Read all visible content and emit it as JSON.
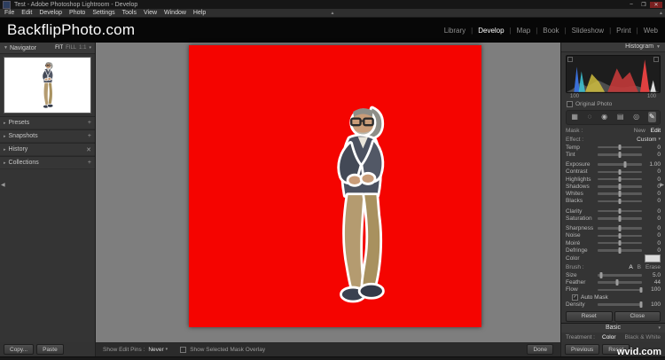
{
  "window": {
    "title": "Test - Adobe Photoshop Lightroom - Develop",
    "minimize": "–",
    "maximize": "❐",
    "close": "✕"
  },
  "menu": {
    "items": [
      "File",
      "Edit",
      "Develop",
      "Photo",
      "Settings",
      "Tools",
      "View",
      "Window",
      "Help"
    ]
  },
  "header": {
    "identity": "BackflipPhoto.com",
    "modules": [
      "Library",
      "Develop",
      "Map",
      "Book",
      "Slideshow",
      "Print",
      "Web"
    ],
    "active_module": "Develop",
    "separator": "|"
  },
  "left": {
    "navigator": {
      "title": "Navigator",
      "fit": "FIT",
      "fill": "FILL",
      "one_to_one": "1:1"
    },
    "panels": [
      {
        "label": "Presets",
        "action": "+"
      },
      {
        "label": "Snapshots",
        "action": "+"
      },
      {
        "label": "History",
        "action": "✕"
      },
      {
        "label": "Collections",
        "action": "+"
      }
    ],
    "copy_button": "Copy...",
    "paste_button": "Paste"
  },
  "toolbar": {
    "edit_pins_label": "Show Edit Pins :",
    "edit_pins_value": "Never",
    "overlay_label": "Show Selected Mask Overlay",
    "done_button": "Done"
  },
  "right": {
    "histogram": {
      "title": "Histogram",
      "info_left": "100",
      "info_right": "100",
      "original_photo": "Original Photo"
    },
    "tool_icons": {
      "crop": "▦",
      "spot_removal": "◌",
      "red_eye": "◉",
      "graduated_filter": "▤",
      "radial_filter": "◎",
      "adjustment_brush": "✎"
    },
    "mask": {
      "label": "Mask :",
      "new_label": "New",
      "edit_label": "Edit"
    },
    "effect": {
      "label": "Effect :",
      "value": "Custom"
    },
    "sliders": [
      {
        "label": "Temp",
        "value": "0"
      },
      {
        "label": "Tint",
        "value": "0"
      },
      {
        "label": "Exposure",
        "value": "1.00"
      },
      {
        "label": "Contrast",
        "value": "0"
      },
      {
        "label": "Highlights",
        "value": "0"
      },
      {
        "label": "Shadows",
        "value": "0"
      },
      {
        "label": "Whites",
        "value": "0"
      },
      {
        "label": "Blacks",
        "value": "0"
      },
      {
        "label": "Clarity",
        "value": "0"
      },
      {
        "label": "Saturation",
        "value": "0"
      },
      {
        "label": "Sharpness",
        "value": "0"
      },
      {
        "label": "Noise",
        "value": "0"
      },
      {
        "label": "Moiré",
        "value": "0"
      },
      {
        "label": "Defringe",
        "value": "0"
      }
    ],
    "color_label": "Color",
    "brush": {
      "label": "Brush :",
      "a": "A",
      "b": "B",
      "erase": "Erase",
      "size": {
        "label": "Size",
        "value": "5.0"
      },
      "feather": {
        "label": "Feather",
        "value": "44"
      },
      "flow": {
        "label": "Flow",
        "value": "100"
      },
      "auto_mask": "Auto Mask",
      "density": {
        "label": "Density",
        "value": "100"
      }
    },
    "reset_button": "Reset",
    "close_button": "Close",
    "basic_header": "Basic",
    "treatment": {
      "label": "Treatment :",
      "color": "Color",
      "bw": "Black & White"
    }
  },
  "bottom_right": {
    "previous_button": "Previous",
    "reset_button": "Reset"
  },
  "watermark": "wvid.com"
}
